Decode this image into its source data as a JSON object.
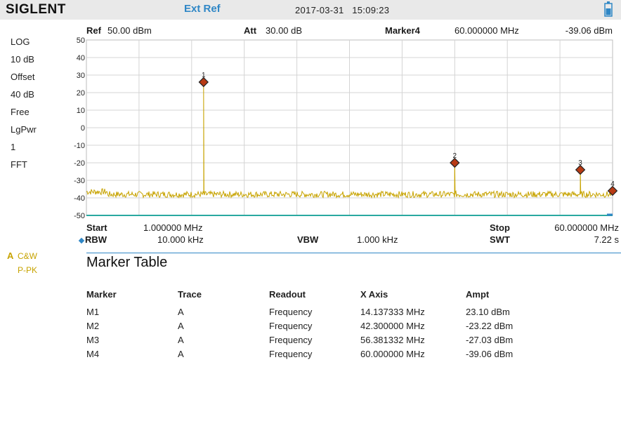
{
  "header": {
    "brand": "SIGLENT",
    "ext_ref": "Ext Ref",
    "date": "2017-03-31",
    "time": "15:09:23",
    "battery_icon": "battery-icon"
  },
  "left_panel": [
    "LOG",
    "10 dB",
    "Offset",
    "40 dB",
    "Free",
    "LgPwr",
    "1",
    "FFT"
  ],
  "trace": {
    "letter": "A",
    "mode1": "C&W",
    "mode2": "P-PK",
    "color": "#c7a300"
  },
  "top_info": {
    "ref_label": "Ref",
    "ref_value": "50.00 dBm",
    "att_label": "Att",
    "att_value": "30.00 dB",
    "marker_label": "Marker4",
    "marker_freq": "60.000000 MHz",
    "marker_ampt": "-39.06 dBm"
  },
  "bottom_info": {
    "start_label": "Start",
    "start_value": "1.000000 MHz",
    "stop_label": "Stop",
    "stop_value": "60.000000 MHz",
    "rbw_label": "RBW",
    "rbw_value": "10.000 kHz",
    "vbw_label": "VBW",
    "vbw_value": "1.000 kHz",
    "swt_label": "SWT",
    "swt_value": "7.22 s"
  },
  "chart_data": {
    "type": "line",
    "x_range_mhz": [
      1,
      60
    ],
    "ylim": [
      -50,
      50
    ],
    "y_ticks": [
      50,
      40,
      30,
      20,
      10,
      0,
      -10,
      -20,
      -30,
      -40,
      -50
    ],
    "noise_floor_dbm": -38,
    "grid": true,
    "trace_color": "#c7a300",
    "reference_line_dbm": -50,
    "reference_line_color": "#2aa9a0",
    "markers": [
      {
        "label": "1",
        "freq_mhz": 14.137333,
        "ampt_dbm": 26
      },
      {
        "label": "2",
        "freq_mhz": 42.3,
        "ampt_dbm": -20
      },
      {
        "label": "3",
        "freq_mhz": 56.381332,
        "ampt_dbm": -24
      },
      {
        "label": "4",
        "freq_mhz": 60.0,
        "ampt_dbm": -36
      }
    ]
  },
  "marker_table": {
    "title": "Marker Table",
    "columns": [
      "Marker",
      "Trace",
      "Readout",
      "X Axis",
      "Ampt"
    ],
    "rows": [
      [
        "M1",
        "A",
        "Frequency",
        "14.137333 MHz",
        "23.10 dBm"
      ],
      [
        "M2",
        "A",
        "Frequency",
        "42.300000 MHz",
        "-23.22 dBm"
      ],
      [
        "M3",
        "A",
        "Frequency",
        "56.381332 MHz",
        "-27.03 dBm"
      ],
      [
        "M4",
        "A",
        "Frequency",
        "60.000000 MHz",
        "-39.06 dBm"
      ]
    ]
  }
}
